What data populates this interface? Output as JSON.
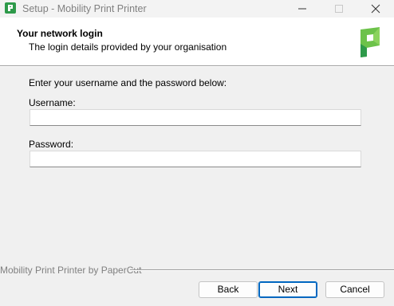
{
  "window": {
    "title": "Setup - Mobility Print Printer"
  },
  "header": {
    "title": "Your network login",
    "subtitle": "The login details provided by your organisation",
    "logo_icon": "papercut-logo-icon"
  },
  "form": {
    "intro": "Enter your username and the password below:",
    "username_label": "Username:",
    "username_value": "",
    "password_label": "Password:",
    "password_value": ""
  },
  "footer": {
    "brand": "Mobility Print Printer by PaperCut",
    "back_label": "Back",
    "next_label": "Next",
    "cancel_label": "Cancel"
  },
  "colors": {
    "accent": "#0067c0",
    "logo_green": "#6cc24a",
    "logo_dark_green": "#2e9a4a"
  }
}
